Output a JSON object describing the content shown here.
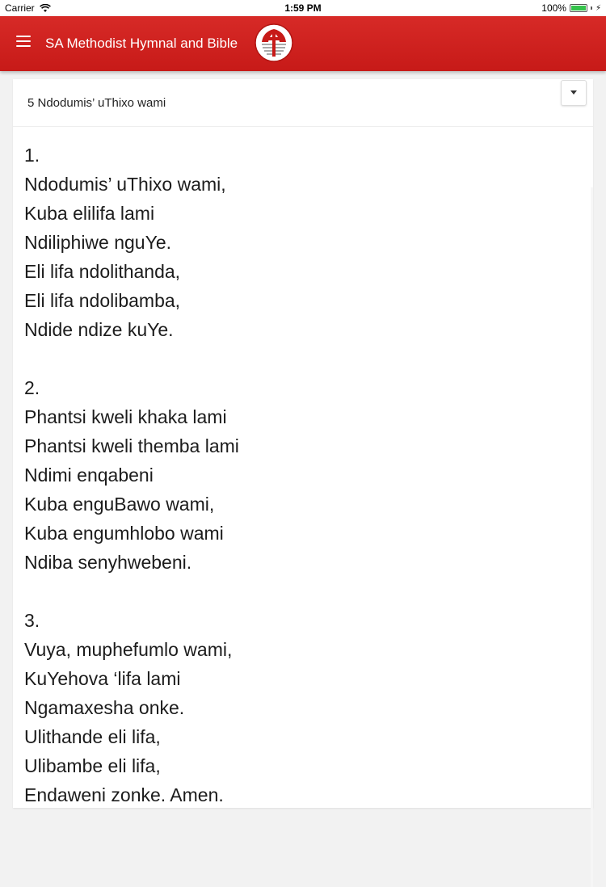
{
  "status_bar": {
    "carrier": "Carrier",
    "time": "1:59 PM",
    "battery": "100%",
    "battery_level": 1.0,
    "battery_color": "#35c24b"
  },
  "app_bar": {
    "title": "SA Methodist Hymnal and Bible",
    "background": "#d0211f",
    "menu_icon": "hamburger-menu-icon",
    "logo_icon": "methodist-cross-logo"
  },
  "hymn": {
    "selected": "5 Ndodumis’ uThixo wami",
    "dropdown_icon": "caret-down-icon",
    "verses": [
      {
        "number": "1.",
        "lines": [
          "Ndodumis’ uThixo wami,",
          "Kuba elilifa lami",
          "Ndiliphiwe nguYe.",
          "Eli lifa ndolithanda,",
          "Eli lifa ndolibamba,",
          "Ndide ndize kuYe."
        ]
      },
      {
        "number": "2.",
        "lines": [
          "Phantsi kweli khaka lami",
          "Phantsi kweli themba lami",
          "Ndimi enqabeni",
          "Kuba enguBawo wami,",
          "Kuba engumhlobo wami",
          "Ndiba senyhwebeni."
        ]
      },
      {
        "number": "3.",
        "lines": [
          "Vuya, muphefumlo wami,",
          "KuYehova ‘lifa lami",
          "Ngamaxesha onke.",
          "Ulithande eli lifa,",
          "Ulibambe eli lifa,",
          "Endaweni zonke. Amen."
        ]
      }
    ]
  }
}
